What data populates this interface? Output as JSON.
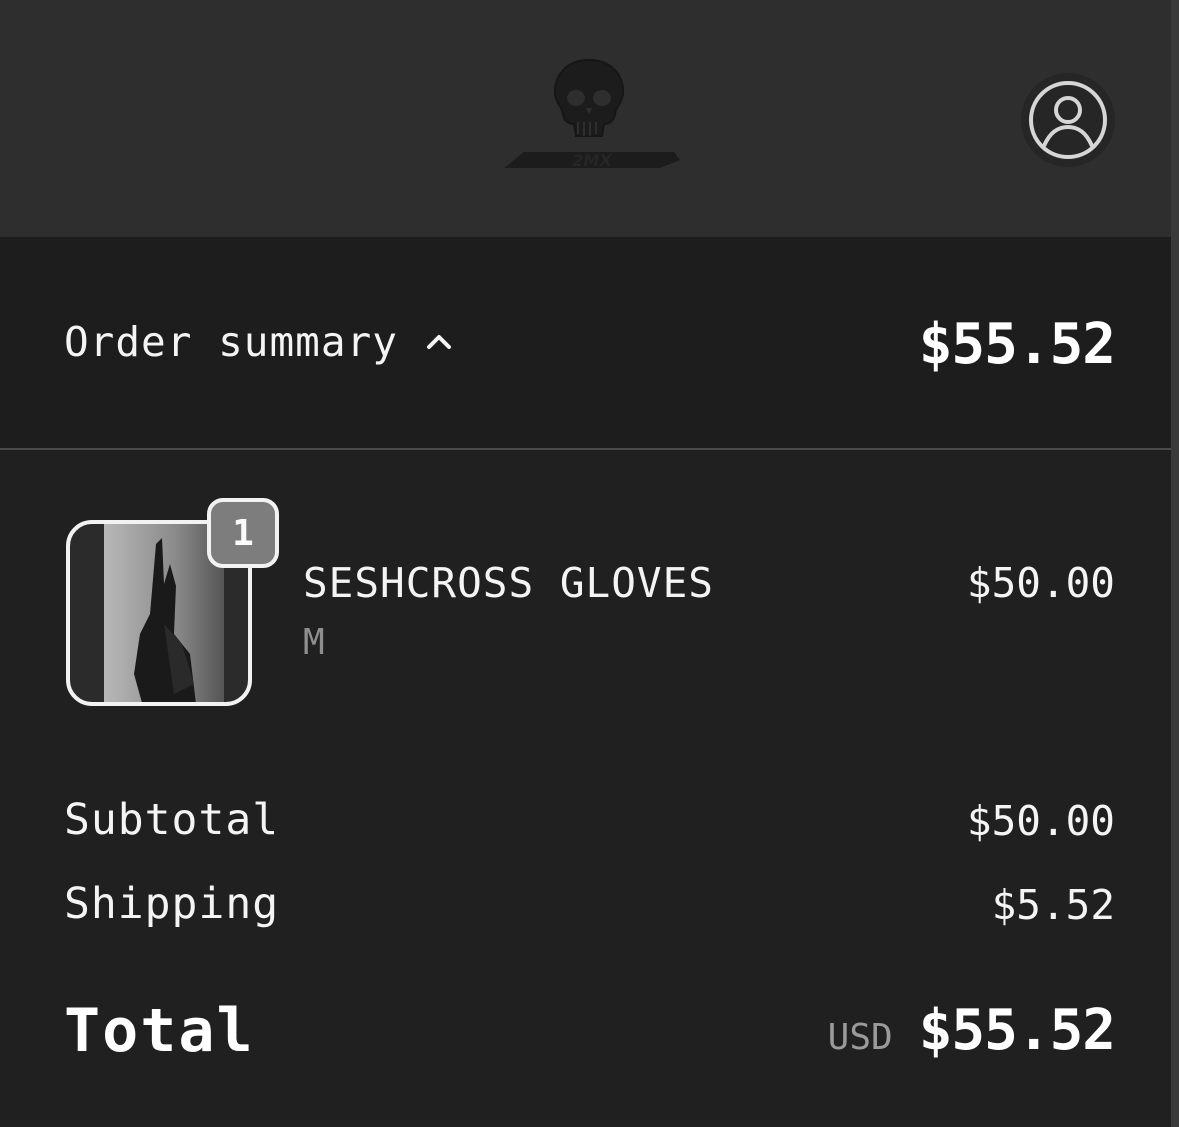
{
  "header": {
    "logo_alt": "skull logo",
    "account_icon": "user-circle-icon"
  },
  "summary": {
    "toggle_label": "Order summary",
    "toggle_icon": "chevron-up-icon",
    "amount": "$55.52"
  },
  "line_items": [
    {
      "quantity": "1",
      "name": "SESHCROSS GLOVES",
      "variant": "M",
      "price": "$50.00"
    }
  ],
  "totals": {
    "subtotal_label": "Subtotal",
    "subtotal_value": "$50.00",
    "shipping_label": "Shipping",
    "shipping_value": "$5.52",
    "total_label": "Total",
    "currency": "USD",
    "total_value": "$55.52"
  },
  "colors": {
    "header_bg": "#2e2e2e",
    "page_bg": "#202020",
    "badge_bg": "#7d7d7d",
    "text": "#f4f4f4",
    "muted": "#8f8f8f"
  }
}
